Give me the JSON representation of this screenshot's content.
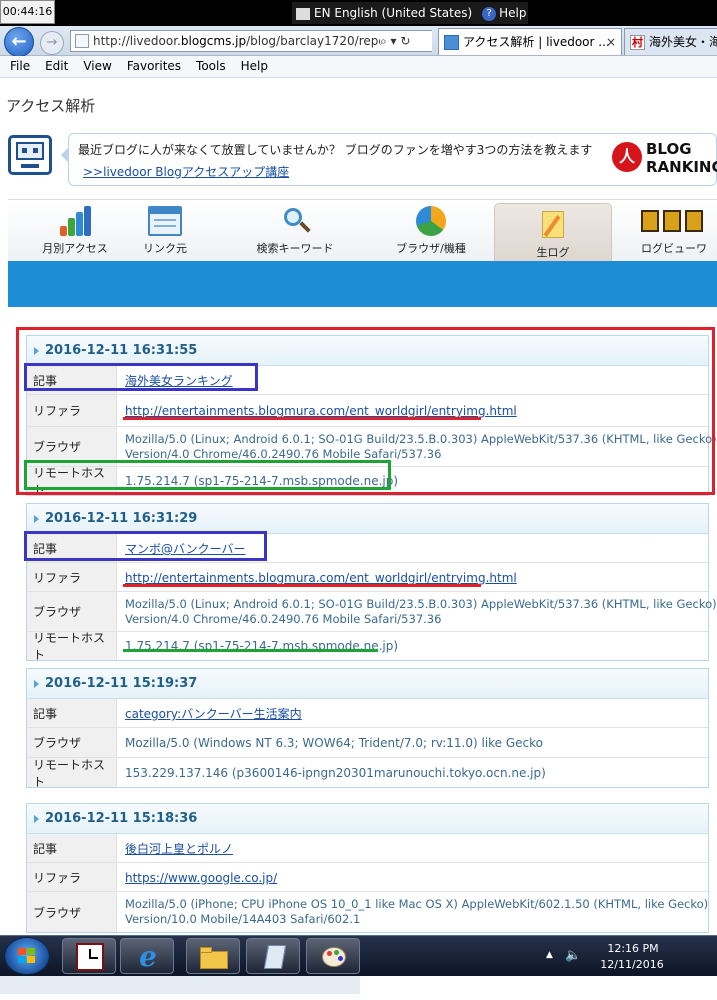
{
  "system": {
    "clock": "00:44:16",
    "language": "EN English (United States)",
    "help": "Help"
  },
  "browser": {
    "url_prefix": "http://livedoor.",
    "url_domain": "blogcms.jp",
    "url_suffix": "/blog/barclay1720/report/",
    "address_tools": "⌕ ▾ ↻",
    "tab_active_title": "アクセス解析 | livedoor ...",
    "tab_active_close": "×",
    "tab_other_title": "海外美女・海",
    "tab_other_icon_text": "村",
    "menu": [
      "File",
      "Edit",
      "View",
      "Favorites",
      "Tools",
      "Help"
    ]
  },
  "page": {
    "title": "アクセス解析",
    "notice_text": "最近ブログに人が来なくて放置していませんか？ ブログのファンを増やす3つの方法を教えます",
    "notice_link": ">>livedoor Blogアクセスアップ講座",
    "ranking_logo_1": "BLOG",
    "ranking_logo_2": "RANKING",
    "ranking_logo_mark": "人"
  },
  "nav_tabs": [
    {
      "label": "月別アクセス",
      "icon": "bar-chart-icon"
    },
    {
      "label": "リンク元",
      "icon": "window-icon"
    },
    {
      "label": "検索キーワード",
      "icon": "magnifier-icon"
    },
    {
      "label": "ブラウザ/機種",
      "icon": "pie-chart-icon"
    },
    {
      "label": "生ログ",
      "icon": "notepad-icon"
    },
    {
      "label": "ログビューワ",
      "icon": "log-viewer-icon"
    }
  ],
  "labels": {
    "article": "記事",
    "referrer": "リファラ",
    "browser": "ブラウザ",
    "remote_host": "リモートホスト"
  },
  "records": [
    {
      "timestamp": "2016-12-11 16:31:55",
      "article": "海外美女ランキング",
      "referrer": "http://entertainments.blogmura.com/ent_worldgirl/entryimg.html",
      "browser_line1": "Mozilla/5.0 (Linux; Android 6.0.1; SO-01G Build/23.5.B.0.303) AppleWebKit/537.36 (KHTML, like Gecko)",
      "browser_line2": "Version/4.0 Chrome/46.0.2490.76 Mobile Safari/537.36",
      "remote_host": "1.75.214.7 (sp1-75-214-7.msb.spmode.ne.jp)"
    },
    {
      "timestamp": "2016-12-11 16:31:29",
      "article": "マンボ@バンクーバー",
      "referrer": "http://entertainments.blogmura.com/ent_worldgirl/entryimg.html",
      "browser_line1": "Mozilla/5.0 (Linux; Android 6.0.1; SO-01G Build/23.5.B.0.303) AppleWebKit/537.36 (KHTML, like Gecko)",
      "browser_line2": "Version/4.0 Chrome/46.0.2490.76 Mobile Safari/537.36",
      "remote_host": "1.75.214.7 (sp1-75-214-7.msb.spmode.ne.jp)"
    },
    {
      "timestamp": "2016-12-11 15:19:37",
      "article": "category:バンクーバー生活案内",
      "browser_line1": "Mozilla/5.0 (Windows NT 6.3; WOW64; Trident/7.0; rv:11.0) like Gecko",
      "remote_host": "153.229.137.146 (p3600146-ipngn20301marunouchi.tokyo.ocn.ne.jp)"
    },
    {
      "timestamp": "2016-12-11 15:18:36",
      "article": "後白河上皇とポルノ",
      "referrer": "https://www.google.co.jp/",
      "browser_line1": "Mozilla/5.0 (iPhone; CPU iPhone OS 10_0_1 like Mac OS X) AppleWebKit/602.1.50 (KHTML, like Gecko)",
      "browser_line2": "Version/10.0 Mobile/14A403 Safari/602.1"
    }
  ],
  "taskbar": {
    "time": "12:16 PM",
    "date": "12/11/2016",
    "tray_up": "▲",
    "tray_speaker": "🔈"
  },
  "colors": {
    "accent_blue": "#1e8dd6",
    "annotation_red": "#e0202a",
    "annotation_blue": "#3a35c8",
    "annotation_green": "#1ea335"
  }
}
